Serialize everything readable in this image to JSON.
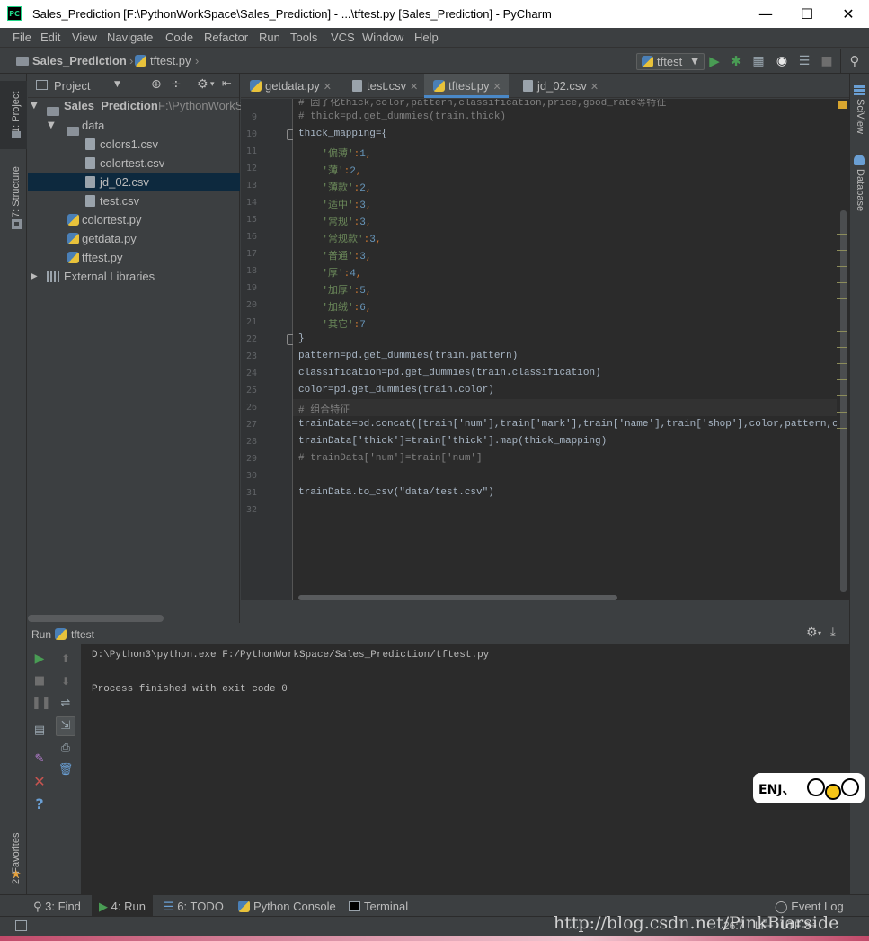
{
  "window": {
    "app_icon": "PC",
    "title": "Sales_Prediction [F:\\PythonWorkSpace\\Sales_Prediction] - ...\\tftest.py [Sales_Prediction] - PyCharm",
    "minimize": "—",
    "maximize": "☐",
    "close": "✕"
  },
  "menu": {
    "items": [
      "File",
      "Edit",
      "View",
      "Navigate",
      "Code",
      "Refactor",
      "Run",
      "Tools",
      "VCS",
      "Window",
      "Help"
    ]
  },
  "breadcrumb": {
    "project": "Sales_Prediction",
    "file": "tftest.py"
  },
  "toolbar": {
    "run_config": "tftest",
    "icons": [
      "run-icon",
      "debug-icon",
      "coverage-icon",
      "profile-icon",
      "concurrency-icon",
      "stop-icon",
      "search-icon"
    ]
  },
  "left_strip": {
    "project_tab": "1: Project",
    "structure_tab": "7: Structure",
    "favorites_tab": "2: Favorites"
  },
  "right_strip": {
    "sciview_tab": "SciView",
    "database_tab": "Database"
  },
  "project_panel": {
    "header_label": "Project",
    "root": "Sales_Prediction",
    "root_path": "F:\\PythonWorkS",
    "items": [
      {
        "label": "data",
        "kind": "folder"
      },
      {
        "label": "colors1.csv",
        "kind": "file"
      },
      {
        "label": "colortest.csv",
        "kind": "file"
      },
      {
        "label": "jd_02.csv",
        "kind": "file"
      },
      {
        "label": "test.csv",
        "kind": "file"
      },
      {
        "label": "colortest.py",
        "kind": "py"
      },
      {
        "label": "getdata.py",
        "kind": "py"
      },
      {
        "label": "tftest.py",
        "kind": "py"
      },
      {
        "label": "External Libraries",
        "kind": "lib"
      }
    ]
  },
  "editor": {
    "tabs": [
      {
        "label": "getdata.py"
      },
      {
        "label": "test.csv"
      },
      {
        "label": "tftest.py",
        "active": true
      },
      {
        "label": "jd_02.csv"
      }
    ],
    "line_numbers": [
      "9",
      "10",
      "11",
      "12",
      "13",
      "14",
      "15",
      "16",
      "17",
      "18",
      "19",
      "20",
      "21",
      "22",
      "23",
      "24",
      "25",
      "26",
      "27",
      "28",
      "29",
      "30",
      "31",
      "32"
    ],
    "top_partial_line": "# 因子化thick,color,pattern,classification,price,good_rate等特征",
    "lines": [
      "# thick=pd.get_dummies(train.thick)",
      "thick_mapping={",
      "    '偏薄':1,",
      "    '薄':2,",
      "    '薄款':2,",
      "    '适中':3,",
      "    '常规':3,",
      "    '常规款':3,",
      "    '普通':3,",
      "    '厚':4,",
      "    '加厚':5,",
      "    '加绒':6,",
      "    '其它':7",
      "}",
      "pattern=pd.get_dummies(train.pattern)",
      "classification=pd.get_dummies(train.classification)",
      "color=pd.get_dummies(train.color)",
      "# 组合特征",
      "trainData=pd.concat([train['num'],train['mark'],train['name'],train['shop'],color,pattern,classificati",
      "trainData['thick']=train['thick'].map(thick_mapping)",
      "# trainData['num']=train['num']",
      "",
      "trainData.to_csv(\"data/test.csv\")",
      ""
    ]
  },
  "run_panel": {
    "title": "Run",
    "config": "tftest",
    "console": [
      "D:\\Python3\\python.exe F:/PythonWorkSpace/Sales_Prediction/tftest.py",
      "",
      "Process finished with exit code 0"
    ]
  },
  "bottom_tools": {
    "find": "3: Find",
    "run": "4: Run",
    "todo": "6: TODO",
    "python_console": "Python Console",
    "terminal": "Terminal",
    "event_log": "Event Log"
  },
  "status": {
    "position": "26:7",
    "line_sep": "LF÷",
    "encoding": "UTF-8÷"
  },
  "overlay": {
    "sticker_text": "ENJ、",
    "watermark": "http://blog.csdn.net/PinkBiarside"
  },
  "colors": {
    "editor_bg": "#2b2b2b",
    "panel_bg": "#3c3f41",
    "selection": "#0d293e",
    "string": "#6a8759",
    "number": "#6897bb",
    "comment": "#808080",
    "run_green": "#499c54",
    "stop_red": "#c75450"
  }
}
